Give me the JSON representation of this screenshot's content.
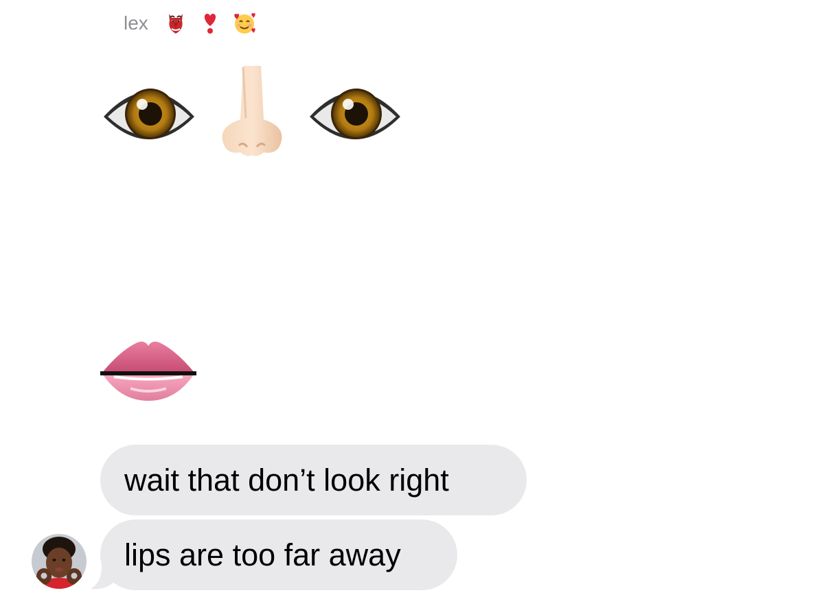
{
  "conversation": {
    "sender_name": "lex",
    "sender_emojis": [
      "goblin-mask-emoji",
      "red-exclamation-heart-emoji",
      "smiling-face-with-hearts-emoji"
    ],
    "emoji_message": [
      "eye-emoji",
      "nose-emoji",
      "eye-emoji",
      "lips-emoji"
    ],
    "messages": [
      {
        "text": "wait that don’t look right"
      },
      {
        "text": "lips are too far away"
      }
    ]
  },
  "colors": {
    "background": "#ffffff",
    "bubble": "#e9e9eb",
    "sender_name": "#8e8e93",
    "message_text": "#000000"
  }
}
